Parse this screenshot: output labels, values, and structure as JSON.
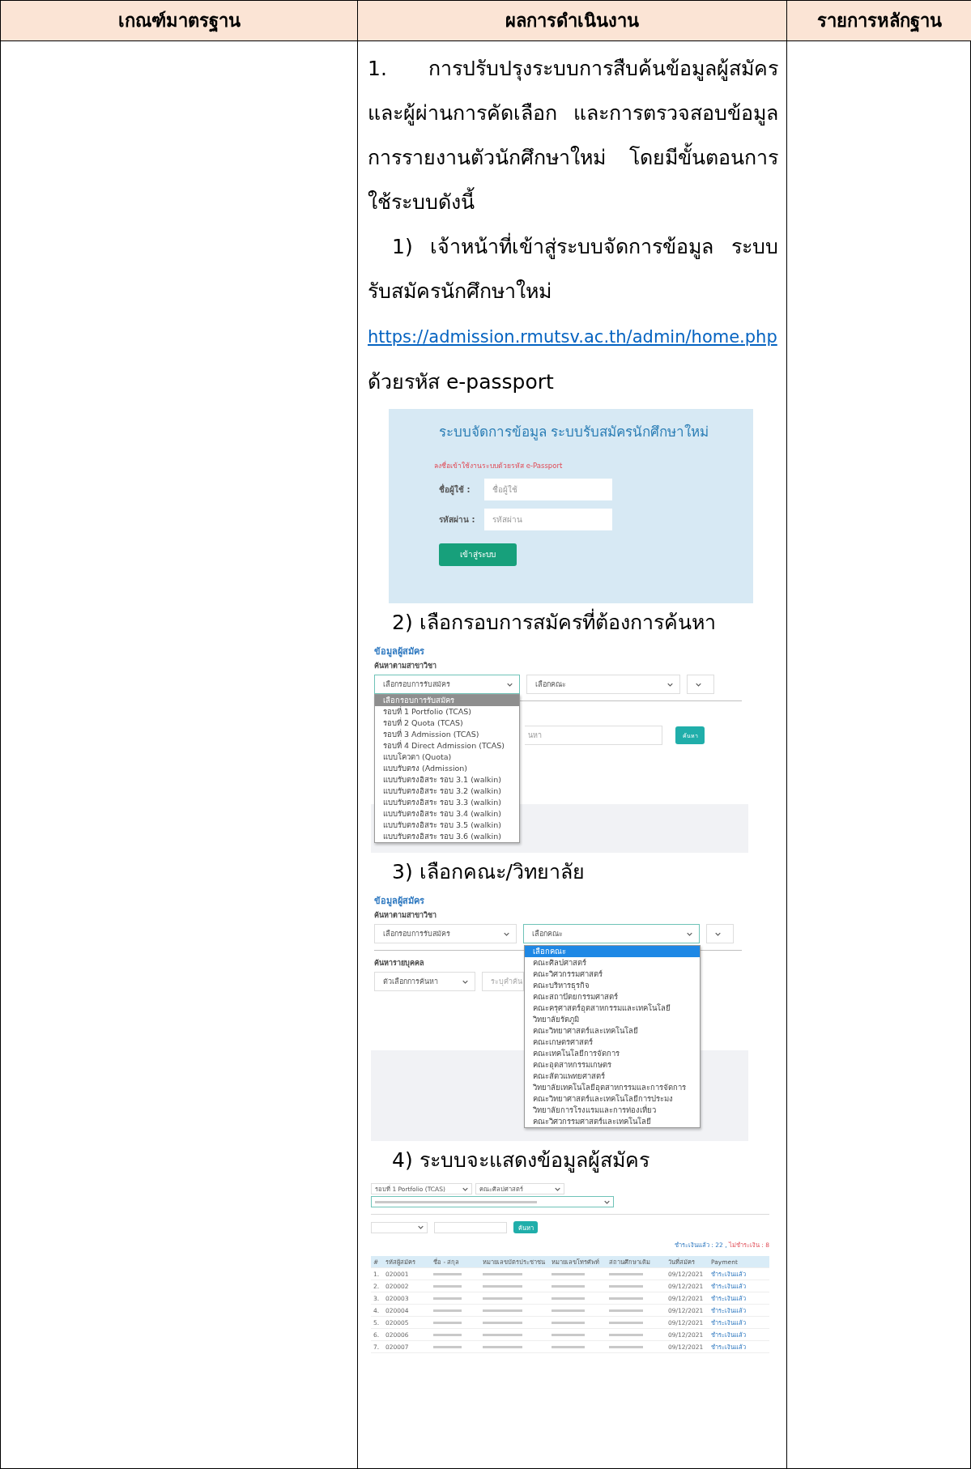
{
  "header": [
    "เกณฑ์มาตรฐาน",
    "ผลการดำเนินงาน",
    "รายการหลักฐาน"
  ],
  "intro": "1. การปรับปรุงระบบการสืบค้นข้อมูลผู้สมัครและผู้ผ่านการคัดเลือก และการตรวจสอบข้อมูลการรายงานตัวนักศึกษาใหม่ โดยมีขั้นตอนการใช้ระบบดังนี้",
  "step_1": {
    "text": "1) เจ้าหน้าที่เข้าสู่ระบบจัดการข้อมูล ระบบรับสมัครนักศึกษาใหม่",
    "link": "https://admission.rmutsv.ac.th/admin/home.php",
    "suffix": "ด้วยรหัส e-passport"
  },
  "login_screen": {
    "title": "ระบบจัดการข้อมูล ระบบรับสมัครนักศึกษาใหม่",
    "notice": "ลงชื่อเข้าใช้งานระบบด้วยรหัส e-Passport",
    "fields": [
      {
        "label": "ชื่อผู้ใช้  :",
        "placeholder": "ชื่อผู้ใช้"
      },
      {
        "label": "รหัสผ่าน  :",
        "placeholder": "รหัสผ่าน"
      }
    ],
    "button": "เข้าสู่ระบบ"
  },
  "step_2": "2) เลือกรอบการสมัครที่ต้องการค้นหา",
  "round_screen": {
    "heading": "ข้อมูลผู้สมัคร",
    "subheading": "ค้นหาตามสาขาวิชา",
    "selects": [
      {
        "value": "เลือกรอบการรับสมัคร",
        "focused": true
      },
      {
        "value": "เลือกคณะ",
        "focused": false
      }
    ],
    "search_placeholder": "นหา",
    "search_button": "ค้นหา",
    "options": [
      {
        "label": "เลือกรอบการรับสมัคร",
        "selected": true
      },
      {
        "label": "รอบที่ 1 Portfolio (TCAS)",
        "selected": false
      },
      {
        "label": "รอบที่ 2 Quota (TCAS)",
        "selected": false
      },
      {
        "label": "รอบที่ 3 Admission (TCAS)",
        "selected": false
      },
      {
        "label": "รอบที่ 4 Direct Admission (TCAS)",
        "selected": false
      },
      {
        "label": "แบบโควตา (Quota)",
        "selected": false
      },
      {
        "label": "แบบรับตรง (Admission)",
        "selected": false
      },
      {
        "label": "แบบรับตรงอิสระ รอบ 3.1 (walkin)",
        "selected": false
      },
      {
        "label": "แบบรับตรงอิสระ รอบ 3.2 (walkin)",
        "selected": false
      },
      {
        "label": "แบบรับตรงอิสระ รอบ 3.3 (walkin)",
        "selected": false
      },
      {
        "label": "แบบรับตรงอิสระ รอบ 3.4 (walkin)",
        "selected": false
      },
      {
        "label": "แบบรับตรงอิสระ รอบ 3.5 (walkin)",
        "selected": false
      },
      {
        "label": "แบบรับตรงอิสระ รอบ 3.6 (walkin)",
        "selected": false
      }
    ]
  },
  "step_3": "3) เลือกคณะ/วิทยาลัย",
  "faculty_screen": {
    "heading": "ข้อมูลผู้สมัคร",
    "subheading": "ค้นหาตามสาขาวิชา",
    "selects": [
      {
        "value": "เลือกรอบการรับสมัคร",
        "focused": false
      },
      {
        "value": "เลือกคณะ",
        "focused": true
      }
    ],
    "person_heading": "ค้นหารายบุคคล",
    "person_select": "ตัวเลือกการค้นหา",
    "person_placeholder": "ระบุคำค้น",
    "options": [
      {
        "label": "เลือกคณะ",
        "selected": true
      },
      {
        "label": "คณะศิลปศาสตร์",
        "selected": false
      },
      {
        "label": "คณะวิศวกรรมศาสตร์",
        "selected": false
      },
      {
        "label": "คณะบริหารธุรกิจ",
        "selected": false
      },
      {
        "label": "คณะสถาปัตยกรรมศาสตร์",
        "selected": false
      },
      {
        "label": "คณะครุศาสตร์อุตสาหกรรมและเทคโนโลยี",
        "selected": false
      },
      {
        "label": "วิทยาลัยรัตภูมิ",
        "selected": false
      },
      {
        "label": "คณะวิทยาศาสตร์และเทคโนโลยี",
        "selected": false
      },
      {
        "label": "คณะเกษตรศาสตร์",
        "selected": false
      },
      {
        "label": "คณะเทคโนโลยีการจัดการ",
        "selected": false
      },
      {
        "label": "คณะอุตสาหกรรมเกษตร",
        "selected": false
      },
      {
        "label": "คณะสัตวแพทยศาสตร์",
        "selected": false
      },
      {
        "label": "วิทยาลัยเทคโนโลยีอุตสาหกรรมและการจัดการ",
        "selected": false
      },
      {
        "label": "คณะวิทยาศาสตร์และเทคโนโลยีการประมง",
        "selected": false
      },
      {
        "label": "วิทยาลัยการโรงแรมและการท่องเที่ยว",
        "selected": false
      },
      {
        "label": "คณะวิศวกรรมศาสตร์และเทคโนโลยี",
        "selected": false
      }
    ]
  },
  "step_4": "4) ระบบจะแสดงข้อมูลผู้สมัคร",
  "applicants_screen": {
    "selects": [
      "รอบที่ 1 Portfolio (TCAS)",
      "คณะศิลปศาสตร์"
    ],
    "search_button": "ค้นหา",
    "paid": "ชำระเงินแล้ว : 22 ,",
    "unpaid": "ไม่ชำระเงิน : 8",
    "columns": [
      "#",
      "รหัสผู้สมัคร",
      "ชื่อ - สกุล",
      "หมายเลขบัตรประชาชน",
      "หมายเลขโทรศัพท์",
      "สถานศึกษาเดิม",
      "วันที่สมัคร",
      "Payment"
    ],
    "rows": [
      {
        "number": "1.",
        "id": "020001",
        "date": "09/12/2021",
        "payment": "ชำระเงินแล้ว"
      },
      {
        "number": "2.",
        "id": "020002",
        "date": "09/12/2021",
        "payment": "ชำระเงินแล้ว"
      },
      {
        "number": "3.",
        "id": "020003",
        "date": "09/12/2021",
        "payment": "ชำระเงินแล้ว"
      },
      {
        "number": "4.",
        "id": "020004",
        "date": "09/12/2021",
        "payment": "ชำระเงินแล้ว"
      },
      {
        "number": "5.",
        "id": "020005",
        "date": "09/12/2021",
        "payment": "ชำระเงินแล้ว"
      },
      {
        "number": "6.",
        "id": "020006",
        "date": "09/12/2021",
        "payment": "ชำระเงินแล้ว"
      },
      {
        "number": "7.",
        "id": "020007",
        "date": "09/12/2021",
        "payment": "ชำระเงินแล้ว"
      }
    ]
  }
}
